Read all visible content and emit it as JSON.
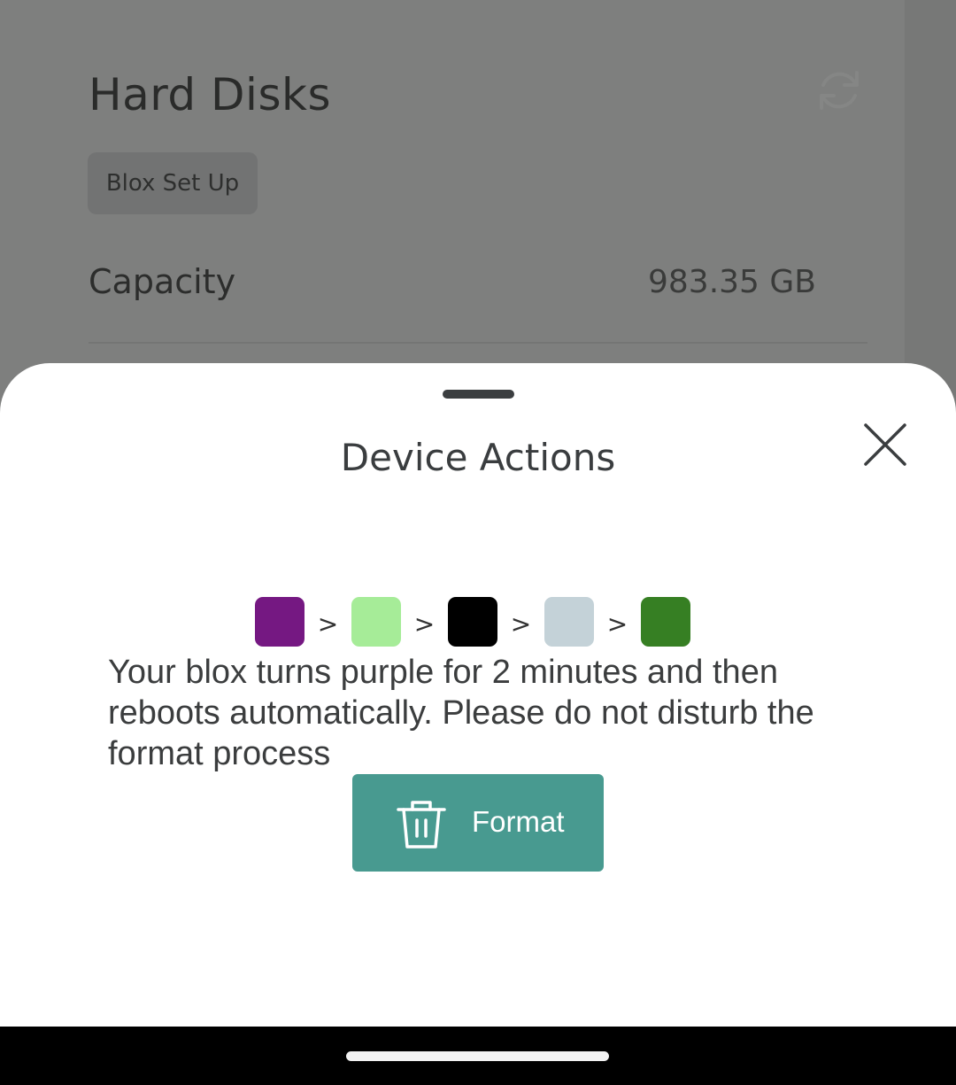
{
  "background": {
    "title": "Hard Disks",
    "chip_label": "Blox Set Up",
    "capacity_label": "Capacity",
    "capacity_value": "983.35 GB",
    "refresh_icon": "refresh-icon"
  },
  "sheet": {
    "title": "Device Actions",
    "close_icon": "close-icon",
    "color_sequence": [
      {
        "color": "#751882"
      },
      {
        "separator": ">",
        "color": "#a6ec98"
      },
      {
        "separator": ">",
        "color": "#000000"
      },
      {
        "separator": ">",
        "color": "#c4d2d8"
      },
      {
        "separator": ">",
        "color": "#367f23"
      }
    ],
    "message": "Your blox turns purple for 2 minutes and then reboots automatically. Please do not disturb the format process",
    "format_button": {
      "label": "Format",
      "icon": "trash-icon",
      "color": "#489a90"
    }
  },
  "colors": {
    "accent": "#489a90",
    "scrim": "#7e7f7e"
  }
}
